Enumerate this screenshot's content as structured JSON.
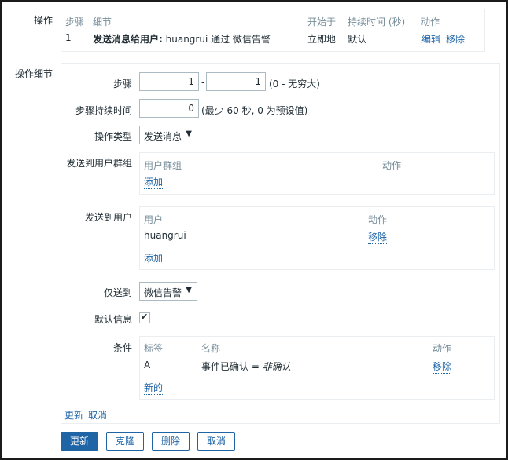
{
  "operations": {
    "label": "操作",
    "headers": {
      "step": "步骤",
      "details": "细节",
      "start_in": "开始于",
      "duration": "持续时间 (秒)",
      "action": "动作"
    },
    "row": {
      "step": "1",
      "details_bold": "发送消息给用户:",
      "details_rest": " huangrui 通过 微信告警",
      "start_in": "立即地",
      "duration": "默认",
      "edit": "编辑",
      "remove": "移除"
    }
  },
  "op_details": {
    "label": "操作细节",
    "steps": {
      "label": "步骤",
      "from": "1",
      "dash": "-",
      "to": "1",
      "hint": "(0 - 无穷大)"
    },
    "step_duration": {
      "label": "步骤持续时间",
      "value": "0",
      "hint": "(最少 60 秒, 0 为预设值)"
    },
    "op_type": {
      "label": "操作类型",
      "value": "发送消息"
    },
    "user_groups": {
      "label": "发送到用户群组",
      "col_group": "用户群组",
      "col_action": "动作",
      "add": "添加"
    },
    "users": {
      "label": "发送到用户",
      "col_user": "用户",
      "col_action": "动作",
      "rows": [
        {
          "user": "huangrui",
          "remove": "移除"
        }
      ],
      "add": "添加"
    },
    "send_only_to": {
      "label": "仅送到",
      "value": "微信告警"
    },
    "default_message": {
      "label": "默认信息",
      "checked": true,
      "check_glyph": "✔"
    },
    "conditions": {
      "label": "条件",
      "col_label": "标签",
      "col_name": "名称",
      "col_action": "动作",
      "rows": [
        {
          "label": "A",
          "name_prefix": "事件已确认 = ",
          "name_value": "非确认",
          "remove": "移除"
        }
      ],
      "new": "新的"
    },
    "update_link": "更新",
    "cancel_link": "取消"
  },
  "buttons": {
    "update": "更新",
    "clone": "克隆",
    "delete": "删除",
    "cancel": "取消"
  },
  "colors": {
    "primary": "#1f65a6",
    "muted": "#768d99",
    "border": "#ebeef0"
  }
}
